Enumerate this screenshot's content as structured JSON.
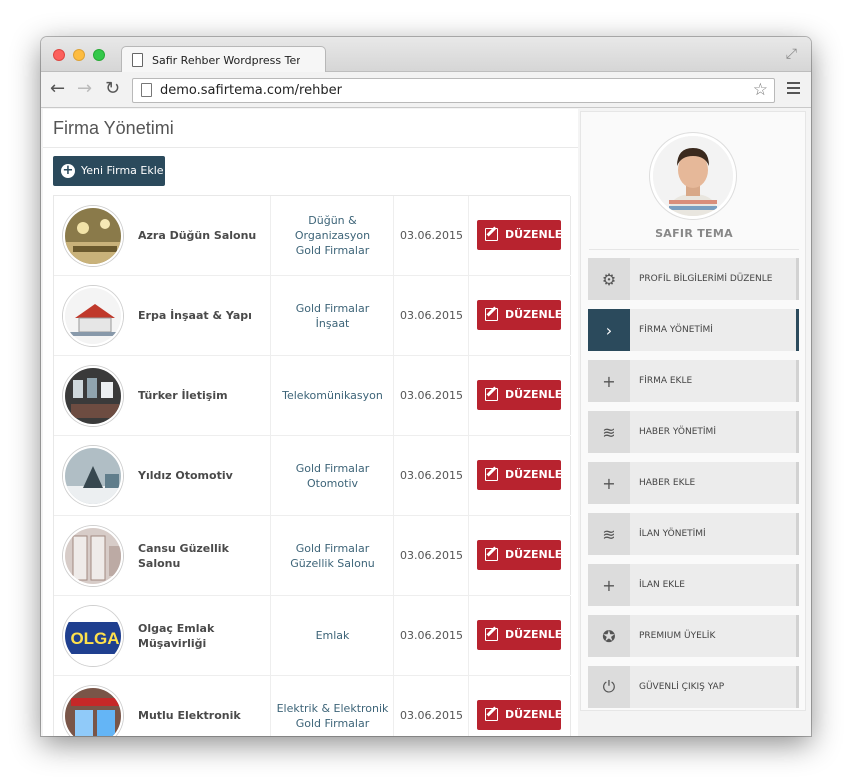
{
  "browser": {
    "tab_title": "Safir Rehber Wordpress Temas",
    "url": "demo.safirtema.com/rehber"
  },
  "page": {
    "title": "Firma Yönetimi",
    "add_button": "Yeni Firma Ekle"
  },
  "firms": [
    {
      "name": "Azra Düğün Salonu",
      "categories": [
        "Düğün &",
        "Organizasyon",
        "Gold Firmalar"
      ],
      "date": "03.06.2015",
      "action": "DÜZENLE"
    },
    {
      "name": "Erpa İnşaat & Yapı",
      "categories": [
        "Gold Firmalar",
        "İnşaat"
      ],
      "date": "03.06.2015",
      "action": "DÜZENLE"
    },
    {
      "name": "Türker İletişim",
      "categories": [
        "Telekomünikasyon"
      ],
      "date": "03.06.2015",
      "action": "DÜZENLE"
    },
    {
      "name": "Yıldız Otomotiv",
      "categories": [
        "Gold Firmalar",
        "Otomotiv"
      ],
      "date": "03.06.2015",
      "action": "DÜZENLE"
    },
    {
      "name": "Cansu Güzellik Salonu",
      "categories": [
        "Gold Firmalar",
        "Güzellik Salonu"
      ],
      "date": "03.06.2015",
      "action": "DÜZENLE"
    },
    {
      "name": "Olgaç Emlak Müşavirliği",
      "categories": [
        "Emlak"
      ],
      "date": "03.06.2015",
      "action": "DÜZENLE",
      "logo_text": "OLGA"
    },
    {
      "name": "Mutlu Elektronik",
      "categories": [
        "Elektrik & Elektronik",
        "Gold Firmalar"
      ],
      "date": "03.06.2015",
      "action": "DÜZENLE"
    }
  ],
  "sidebar": {
    "profile_name": "SAFIR TEMA",
    "menu": [
      {
        "label": "PROFİL BİLGİLERİMİ DÜZENLE",
        "icon": "gear-icon"
      },
      {
        "label": "FİRMA YÖNETİMİ",
        "icon": "chevron-right-icon",
        "active": true
      },
      {
        "label": "FİRMA EKLE",
        "icon": "plus-icon"
      },
      {
        "label": "HABER YÖNETİMİ",
        "icon": "layers-icon"
      },
      {
        "label": "HABER EKLE",
        "icon": "plus-icon"
      },
      {
        "label": "İLAN YÖNETİMİ",
        "icon": "layers-icon"
      },
      {
        "label": "İLAN EKLE",
        "icon": "plus-icon"
      },
      {
        "label": "PREMIUM ÜYELİK",
        "icon": "award-icon"
      },
      {
        "label": "GÜVENLİ ÇIKIŞ YAP",
        "icon": "power-icon"
      }
    ]
  },
  "colors": {
    "primary": "#2b4a5c",
    "danger": "#b8232f",
    "category_text": "#3d6478"
  }
}
